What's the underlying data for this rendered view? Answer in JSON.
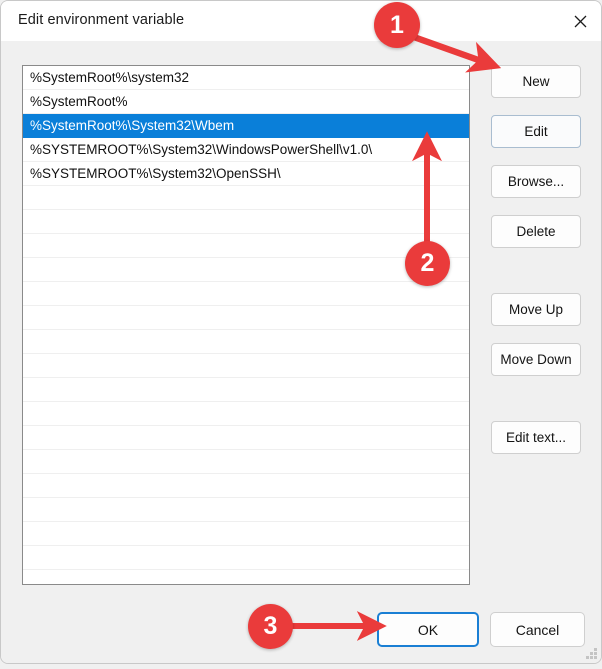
{
  "window": {
    "title": "Edit environment variable",
    "close_icon": "close-icon"
  },
  "list": {
    "items": [
      {
        "text": "%SystemRoot%\\system32",
        "selected": false
      },
      {
        "text": "%SystemRoot%",
        "selected": false
      },
      {
        "text": "%SystemRoot%\\System32\\Wbem",
        "selected": true
      },
      {
        "text": "%SYSTEMROOT%\\System32\\WindowsPowerShell\\v1.0\\",
        "selected": false
      },
      {
        "text": "%SYSTEMROOT%\\System32\\OpenSSH\\",
        "selected": false
      }
    ],
    "empty_row_count": 16,
    "selection_color": "#0a7fd9"
  },
  "side_buttons": {
    "new": "New",
    "edit": "Edit",
    "browse": "Browse...",
    "delete": "Delete",
    "move_up": "Move Up",
    "move_down": "Move Down",
    "edit_text": "Edit text..."
  },
  "footer": {
    "ok": "OK",
    "cancel": "Cancel"
  },
  "annotations": {
    "color": "#ea3b3b",
    "markers": [
      {
        "label": "1",
        "points_to": "new-button",
        "arrow": "diagonal-down-right"
      },
      {
        "label": "2",
        "points_to": "list-box",
        "arrow": "up"
      },
      {
        "label": "3",
        "points_to": "ok-button",
        "arrow": "right"
      }
    ]
  }
}
